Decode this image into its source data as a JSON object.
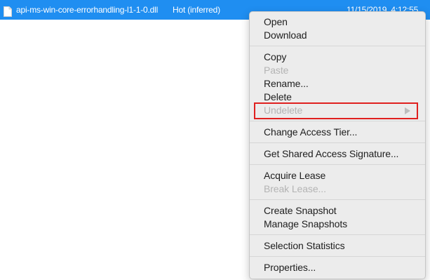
{
  "file_row": {
    "name": "api-ms-win-core-errorhandling-l1-1-0.dll",
    "access_tier": "Hot (inferred)",
    "last_modified": "11/15/2019, 4:12:55"
  },
  "context_menu": {
    "open": "Open",
    "download": "Download",
    "copy": "Copy",
    "paste": "Paste",
    "rename": "Rename...",
    "delete": "Delete",
    "undelete": "Undelete",
    "change_access_tier": "Change Access Tier...",
    "get_sas": "Get Shared Access Signature...",
    "acquire_lease": "Acquire Lease",
    "break_lease": "Break Lease...",
    "create_snapshot": "Create Snapshot",
    "manage_snapshots": "Manage Snapshots",
    "selection_statistics": "Selection Statistics",
    "properties": "Properties..."
  },
  "colors": {
    "selection": "#1f8ef1",
    "highlight_box": "#e0201f",
    "disabled_text": "#b4b4b4"
  },
  "icons": {
    "file": "document-icon",
    "submenu": "chevron-right-icon"
  }
}
